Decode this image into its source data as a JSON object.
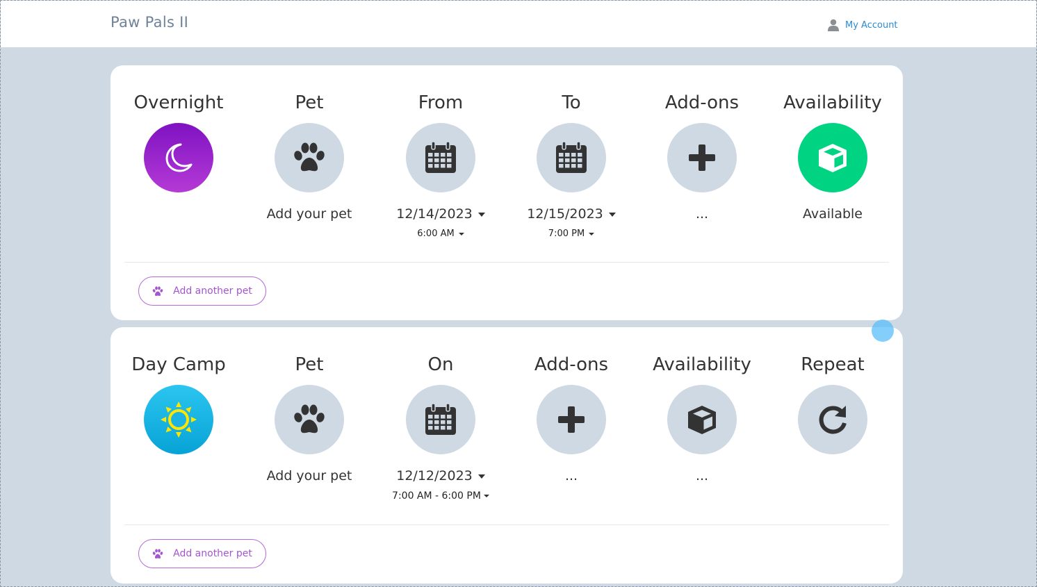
{
  "header": {
    "brand": "Paw Pals II",
    "account_label": "My Account",
    "account_icon": "user-icon"
  },
  "overnight": {
    "service": {
      "title": "Overnight",
      "icon": "moon-icon",
      "color_top": "#8a18c8",
      "color_bottom": "#b53ad6"
    },
    "pet": {
      "title": "Pet",
      "icon": "paw-icon",
      "value": "Add your pet"
    },
    "from": {
      "title": "From",
      "icon": "calendar-icon",
      "date": "12/14/2023",
      "time": "6:00 AM"
    },
    "to": {
      "title": "To",
      "icon": "calendar-icon",
      "date": "12/15/2023",
      "time": "7:00 PM"
    },
    "addons": {
      "title": "Add-ons",
      "icon": "plus-icon",
      "value": "..."
    },
    "availability": {
      "title": "Availability",
      "icon": "cube-icon",
      "value": "Available",
      "color": "#00d483"
    },
    "add_pet_label": "Add another pet"
  },
  "daycamp": {
    "service": {
      "title": "Day Camp",
      "icon": "sun-icon",
      "color_top": "#23c0ee",
      "color_bottom": "#0aa6d8"
    },
    "pet": {
      "title": "Pet",
      "icon": "paw-icon",
      "value": "Add your pet"
    },
    "on": {
      "title": "On",
      "icon": "calendar-icon",
      "date": "12/12/2023",
      "time": "7:00 AM - 6:00 PM"
    },
    "addons": {
      "title": "Add-ons",
      "icon": "plus-icon",
      "value": "..."
    },
    "availability": {
      "title": "Availability",
      "icon": "cube-icon",
      "value": "..."
    },
    "repeat": {
      "title": "Repeat",
      "icon": "redo-icon"
    },
    "add_pet_label": "Add another pet"
  },
  "colors": {
    "background": "#cfd9e3",
    "accent_purple": "#a355d0",
    "link_blue": "#2a8ad4"
  }
}
